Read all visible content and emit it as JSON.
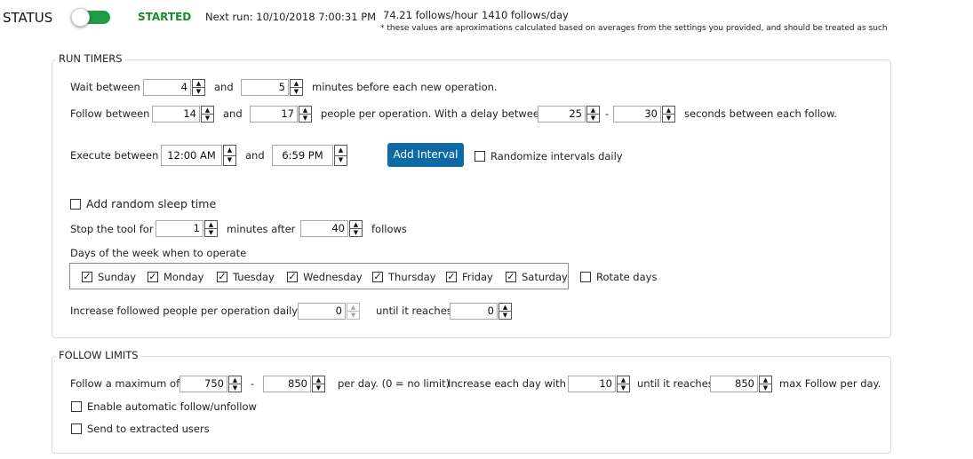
{
  "header": {
    "status_label": "STATUS",
    "toggle_on": true,
    "status_value": "STARTED",
    "next_run": "Next run: 10/10/2018 7:00:31 PM",
    "follows_hour": "74.21 follows/hour",
    "follows_day": "1410 follows/day",
    "note": "* these values are aproximations calculated based on averages from the settings you provided, and should be treated as such"
  },
  "run_timers": {
    "title": "RUN TIMERS",
    "wait_label": "Wait between",
    "wait_min": "4",
    "wait_and": "and",
    "wait_max": "5",
    "wait_suffix": "minutes before each new operation.",
    "follow_label": "Follow between",
    "follow_min": "14",
    "follow_and": "and",
    "follow_max": "17",
    "follow_suffix": "people per operation. With a delay between",
    "delay_min": "25",
    "delay_dash": "-",
    "delay_max": "30",
    "delay_suffix": "seconds between each follow.",
    "execute_label": "Execute between",
    "execute_start": "12:00 AM",
    "execute_and": "and",
    "execute_end": "6:59 PM",
    "add_interval": "Add Interval",
    "randomize_label": "Randomize intervals daily",
    "random_sleep_label": "Add random sleep time",
    "stop_label": "Stop the tool for",
    "stop_minutes": "1",
    "stop_after": "minutes after",
    "stop_follows": "40",
    "stop_follows_suffix": "follows",
    "days_title": "Days of the week when to operate",
    "days": [
      {
        "label": "Sunday",
        "checked": true
      },
      {
        "label": "Monday",
        "checked": true
      },
      {
        "label": "Tuesday",
        "checked": true
      },
      {
        "label": "Wednesday",
        "checked": true
      },
      {
        "label": "Thursday",
        "checked": true
      },
      {
        "label": "Friday",
        "checked": true
      },
      {
        "label": "Saturday",
        "checked": true
      }
    ],
    "rotate_days_label": "Rotate days",
    "increase_label": "Increase followed people per operation daily by",
    "increase_value": "0",
    "until_label": "until it reaches",
    "until_value": "0"
  },
  "follow_limits": {
    "title": "FOLLOW LIMITS",
    "max_label": "Follow a maximum of",
    "max_min": "750",
    "max_dash": "-",
    "max_max": "850",
    "per_day_label": "per day. (0 = no limit)",
    "increase_label": "Increase each day with",
    "increase_value": "10",
    "until_label": "until it reaches",
    "until_value": "850",
    "max_suffix": "max Follow per day.",
    "auto_follow_label": "Enable automatic follow/unfollow",
    "extracted_label": "Send to extracted users"
  }
}
